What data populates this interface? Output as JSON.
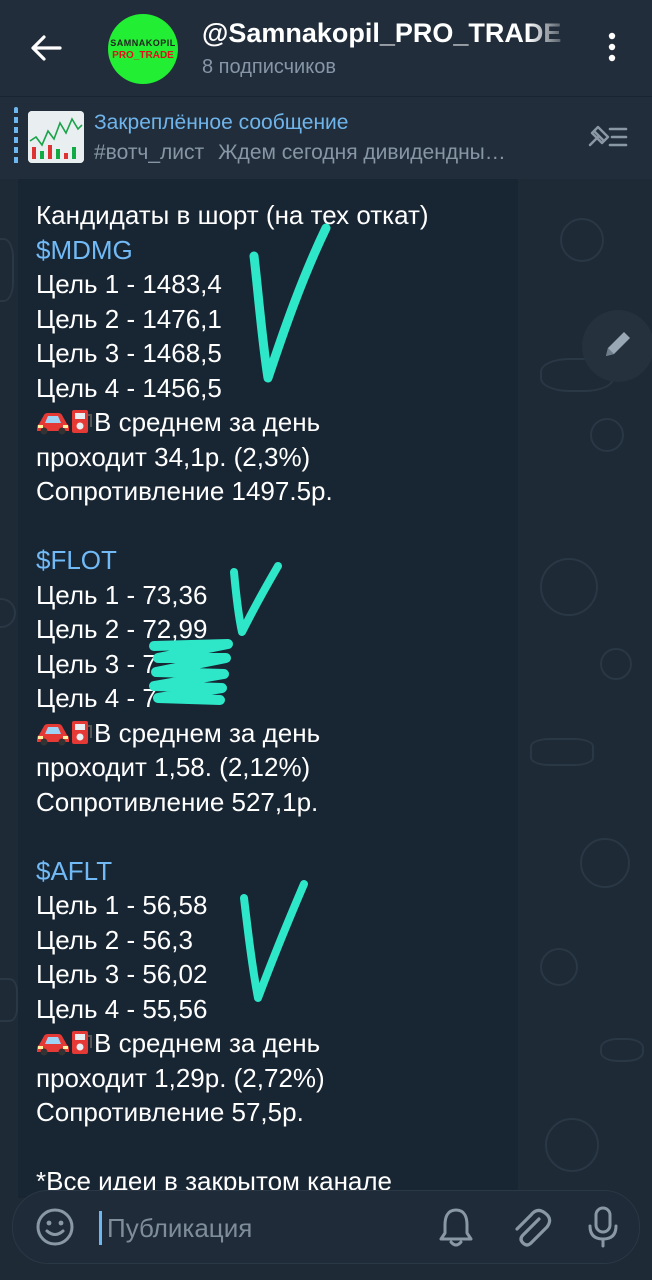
{
  "header": {
    "title": "@Samnakopil_PRO_TRADE",
    "subscribers": "8 подписчиков",
    "avatar_text_top": "SAMNAKOPIL",
    "avatar_text_bottom": "PRO_TRADE"
  },
  "pinned": {
    "title": "Закреплённое сообщение",
    "tag": "#вотч_лист",
    "text": "Ждем сегодня дивидендны…"
  },
  "message": {
    "heading": "Кандидаты в шорт (на тех откат)",
    "blocks": [
      {
        "ticker": "$MDMG",
        "targets": [
          "Цель 1 - 1483,4",
          "Цель 2 - 1476,1",
          "Цель 3 - 1468,5",
          "Цель 4 - 1456,5"
        ],
        "avg_line1": "В среднем за день",
        "avg_line2": "проходит 34,1р. (2,3%)",
        "resistance": "Сопротивление 1497.5р."
      },
      {
        "ticker": "$FLOT",
        "targets": [
          "Цель 1 - 73,36",
          "Цель 2 - 72,99",
          "Цель 3 - 7",
          "Цель 4 - 7"
        ],
        "avg_line1": "В среднем за день",
        "avg_line2": "проходит 1,58. (2,12%)",
        "resistance": "Сопротивление 527,1р."
      },
      {
        "ticker": "$AFLT",
        "targets": [
          "Цель 1 - 56,58",
          "Цель 2 - 56,3",
          "Цель 3 - 56,02",
          "Цель 4 - 55,56"
        ],
        "avg_line1": "В среднем за день",
        "avg_line2": "проходит 1,29р. (2,72%)",
        "resistance": "Сопротивление 57,5р."
      }
    ],
    "footer": "*Все идеи в закрытом канале"
  },
  "composer": {
    "placeholder": "Публикация"
  },
  "icons": {
    "back": "arrow-left-icon",
    "menu": "more-vertical-icon",
    "unpin": "unpin-list-icon",
    "edit": "pencil-icon",
    "emoji": "smile-icon",
    "bell": "bell-icon",
    "attach": "paperclip-icon",
    "mic": "microphone-icon"
  },
  "colors": {
    "accent": "#6cb7ef",
    "ticker": "#71baf6",
    "checkmark": "#2ee6c8",
    "header_bg": "#212d3b",
    "bubble_bg": "#182533"
  }
}
